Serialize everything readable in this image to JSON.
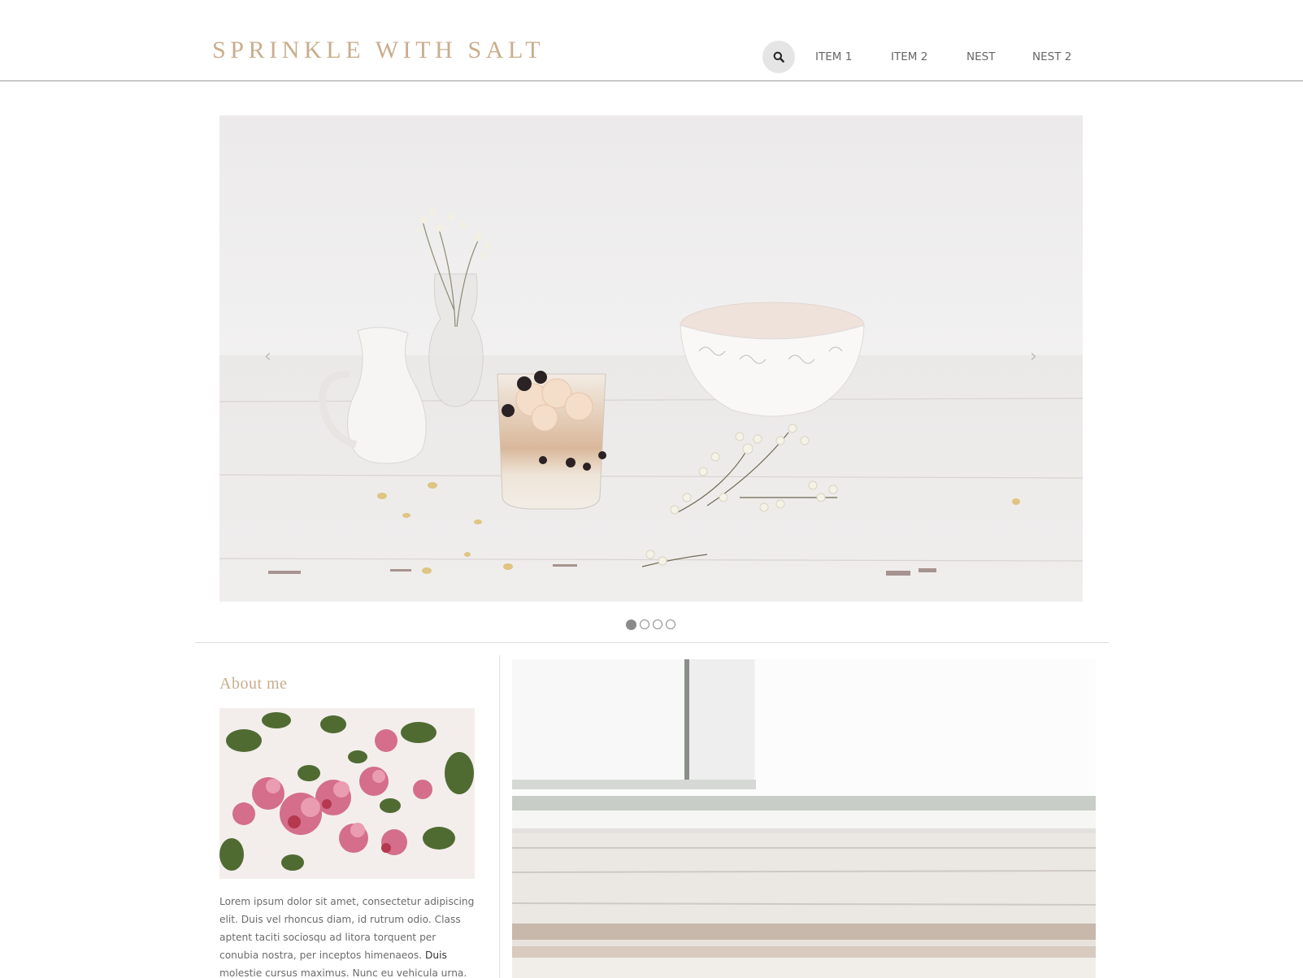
{
  "header": {
    "site_title": "SPRINKLE WITH SALT",
    "search_icon": "search-icon",
    "nav": [
      {
        "label": "ITEM 1"
      },
      {
        "label": "ITEM 2"
      },
      {
        "label": "NEST"
      },
      {
        "label": "NEST 2"
      }
    ]
  },
  "slider": {
    "prev_symbol": "‹",
    "next_symbol": "›",
    "slide_count": 4,
    "active_slide": 1
  },
  "sidebar": {
    "title": "About me",
    "text_start": "Lorem ipsum dolor sit amet, consectetur adipiscing elit. Duis vel rhoncus diam, id rutrum odio. Class aptent taciti sociosqu ad litora torquent per conubia nostra, per inceptos himenaeos. ",
    "text_bold": "Duis",
    "text_end": " molestie cursus maximus. Nunc eu vehicula urna. Cras at tempor"
  },
  "colors": {
    "brand": "#c9ad8d",
    "nav_text": "#666666",
    "search_bg": "#e5e5e5"
  }
}
